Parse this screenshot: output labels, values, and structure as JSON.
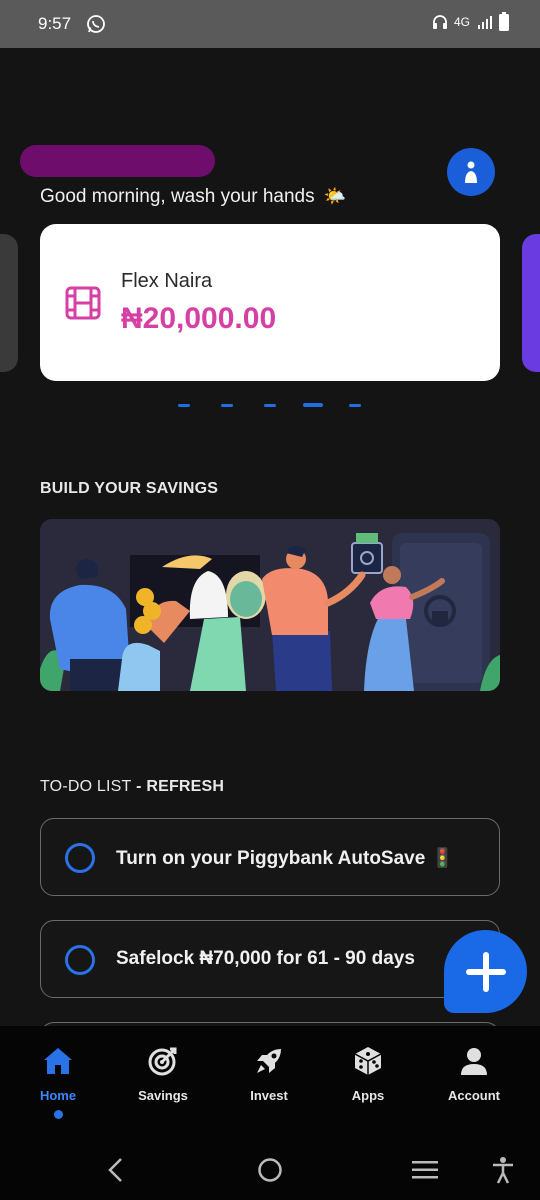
{
  "status_bar": {
    "time": "9:57",
    "network": "4G",
    "icons": [
      "whatsapp-icon",
      "headphones-icon",
      "signal-icon",
      "battery-icon"
    ]
  },
  "header": {
    "greeting": "Good morning, wash your hands",
    "greeting_icon": "🌤️",
    "profile_icon": "info-person-icon"
  },
  "balance_card": {
    "title": "Flex Naira",
    "amount": "₦20,000.00",
    "icon": "film-strip-icon",
    "accent": "#d63fa4"
  },
  "carousel": {
    "page_count": 5,
    "active_index": 3
  },
  "savings": {
    "section_title": "BUILD YOUR SAVINGS",
    "banner_icon": "savings-illustration"
  },
  "todo": {
    "section_title": "TO-DO LIST",
    "section_suffix": " - REFRESH",
    "items": [
      {
        "text": "Turn on your Piggybank AutoSave 🚦"
      },
      {
        "text": "Safelock ₦70,000 for 61 - 90 days"
      },
      {
        "text": ""
      }
    ]
  },
  "fab": {
    "icon": "plus-icon"
  },
  "bottom_nav": {
    "items": [
      {
        "label": "Home",
        "icon": "home-icon",
        "active": true
      },
      {
        "label": "Savings",
        "icon": "target-icon",
        "active": false
      },
      {
        "label": "Invest",
        "icon": "rocket-icon",
        "active": false
      },
      {
        "label": "Apps",
        "icon": "dice-icon",
        "active": false
      },
      {
        "label": "Account",
        "icon": "person-icon",
        "active": false
      }
    ]
  },
  "colors": {
    "background": "#141414",
    "primary_blue": "#1a6ae8",
    "nav_active": "#3a86ff"
  }
}
